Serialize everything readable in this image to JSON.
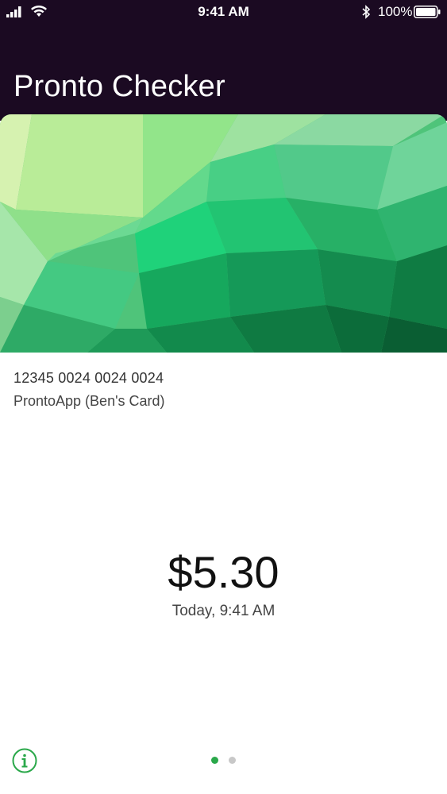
{
  "status_bar": {
    "time": "9:41 AM",
    "battery_percent": "100%",
    "icons": [
      "signal-icon",
      "wifi-icon",
      "bluetooth-icon",
      "battery-icon"
    ]
  },
  "header": {
    "title": "Pronto Checker"
  },
  "card": {
    "number": "12345 0024 0024 0024",
    "name": "ProntoApp (Ben's Card)"
  },
  "balance": {
    "amount": "$5.30",
    "updated": "Today, 9:41 AM"
  },
  "footer": {
    "info_icon": "info-icon",
    "page_count": 2,
    "current_page": 1
  },
  "colors": {
    "header_bg": "#1b0a22",
    "accent_green": "#2aa84a",
    "dot_inactive": "#c8c8c8"
  }
}
